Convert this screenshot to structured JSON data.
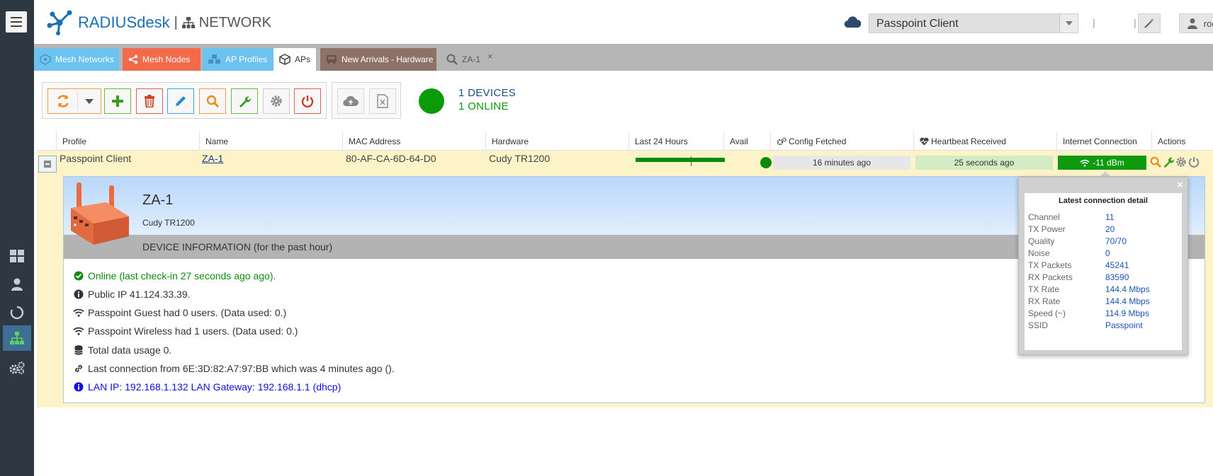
{
  "header": {
    "brand": "RADIUSdesk",
    "separator": "|",
    "section": "NETWORK",
    "realm_value": "Passpoint Client",
    "divider": "|",
    "user": "root"
  },
  "tabs": [
    {
      "label": "Mesh Networks"
    },
    {
      "label": "Mesh Nodes"
    },
    {
      "label": "AP Profiles"
    },
    {
      "label": "APs"
    },
    {
      "label": "New Arrivals - Hardware"
    },
    {
      "label": "ZA-1"
    }
  ],
  "tab_close": "×",
  "summary": {
    "devices": "1 DEVICES",
    "online": "1 ONLINE"
  },
  "grid": {
    "columns": [
      "Profile",
      "Name",
      "MAC Address",
      "Hardware",
      "Last 24 Hours",
      "Avail",
      "Config Fetched",
      "Heartbeat Received",
      "Internet Connection",
      "Actions"
    ],
    "row": {
      "profile": "Passpoint Client",
      "name": "ZA-1",
      "mac": "80-AF-CA-6D-64-D0",
      "hardware": "Cudy TR1200",
      "config_fetched": "16 minutes ago",
      "heartbeat": "25 seconds ago",
      "internet": "-11 dBm"
    }
  },
  "detail": {
    "title": "ZA-1",
    "hardware": "Cudy TR1200",
    "section": "DEVICE INFORMATION (for the past hour)",
    "lines": [
      "Online (last check-in 27 seconds ago ago).",
      "Public IP 41.124.33.39.",
      "Passpoint Guest had 0 users. (Data used: 0.)",
      "Passpoint Wireless had 1 users. (Data used: 0.)",
      "Total data usage 0.",
      "Last connection from 6E:3D:82:A7:97:BB which was 4 minutes ago ().",
      "LAN IP: 192.168.1.132 LAN Gateway: 192.168.1.1 (dhcp)"
    ]
  },
  "popover": {
    "title": "Latest connection detail",
    "close": "×",
    "rows": [
      {
        "k": "Channel",
        "v": "11"
      },
      {
        "k": "TX Power",
        "v": "20"
      },
      {
        "k": "Quality",
        "v": "70/70"
      },
      {
        "k": "Noise",
        "v": "0"
      },
      {
        "k": "TX Packets",
        "v": "45241"
      },
      {
        "k": "RX Packets",
        "v": "83590"
      },
      {
        "k": "TX Rate",
        "v": "144.4 Mbps"
      },
      {
        "k": "RX Rate",
        "v": "144.4 Mbps"
      },
      {
        "k": "Speed (~)",
        "v": "114.9 Mbps"
      },
      {
        "k": "SSID",
        "v": "Passpoint"
      }
    ]
  },
  "colors": {
    "sidebar": "#2e3842",
    "brand_blue": "#1a6fb5",
    "online_green": "#0a9a0a",
    "row_highlight": "#fdf3c9"
  }
}
